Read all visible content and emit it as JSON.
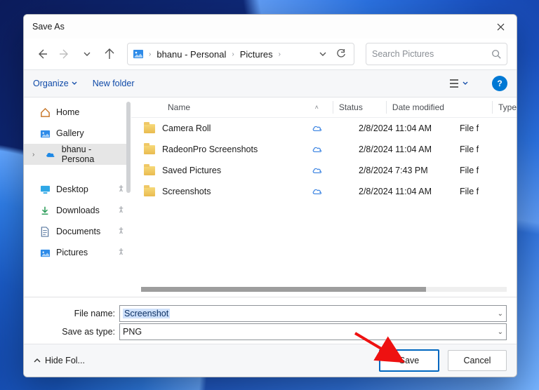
{
  "titlebar": {
    "title": "Save As"
  },
  "nav": {
    "refresh_label": "Refresh",
    "back_label": "Back",
    "forward_label": "Forward",
    "recent_label": "Recent",
    "up_label": "Up"
  },
  "breadcrumbs": {
    "root": "bhanu - Personal",
    "folder": "Pictures"
  },
  "search": {
    "placeholder": "Search Pictures"
  },
  "toolbar": {
    "organize": "Organize",
    "newfolder": "New folder"
  },
  "sidebar": {
    "home": "Home",
    "gallery": "Gallery",
    "onedrive": "bhanu - Persona",
    "desktop": "Desktop",
    "downloads": "Downloads",
    "documents": "Documents",
    "pictures": "Pictures"
  },
  "columns": {
    "name": "Name",
    "status": "Status",
    "date": "Date modified",
    "type": "Type"
  },
  "rows": [
    {
      "name": "Camera Roll",
      "date": "2/8/2024 11:04 AM",
      "type": "File f"
    },
    {
      "name": "RadeonPro Screenshots",
      "date": "2/8/2024 11:04 AM",
      "type": "File f"
    },
    {
      "name": "Saved Pictures",
      "date": "2/8/2024 7:43 PM",
      "type": "File f"
    },
    {
      "name": "Screenshots",
      "date": "2/8/2024 11:04 AM",
      "type": "File f"
    }
  ],
  "form": {
    "filename_label": "File name:",
    "filename_value": "Screenshot",
    "savetype_label": "Save as type:",
    "savetype_value": "PNG"
  },
  "footer": {
    "hide_folders": "Hide Fol...",
    "save": "Save",
    "cancel": "Cancel"
  }
}
